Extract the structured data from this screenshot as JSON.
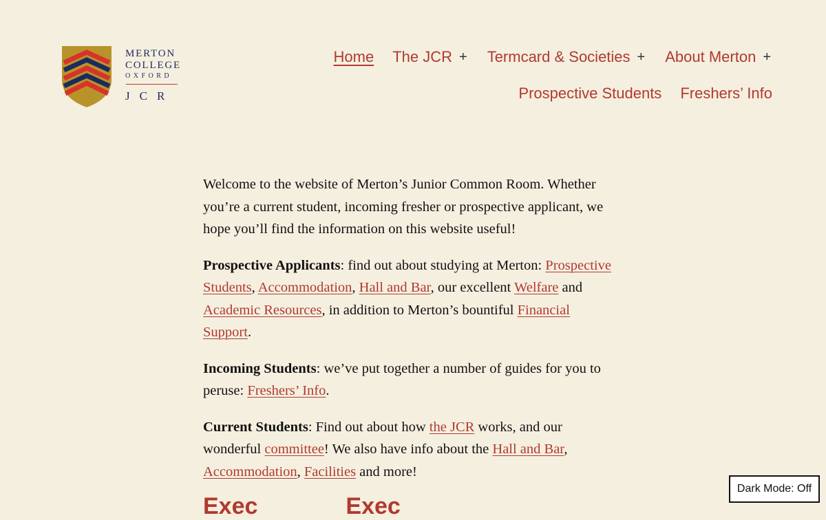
{
  "logo": {
    "line1": "MERTON",
    "line2": "COLLEGE",
    "line3": "OXFORD",
    "line4": "JCR",
    "colors": {
      "gold": "#b8932a",
      "navy": "#1d2b5c",
      "red": "#d8322b"
    }
  },
  "nav": {
    "items": [
      {
        "label": "Home",
        "current": true
      },
      {
        "label": "The JCR",
        "expand_symbol": "+"
      },
      {
        "label": "Termcard & Societies",
        "expand_symbol": "+"
      },
      {
        "label": "About Merton",
        "expand_symbol": "+"
      },
      {
        "label": "Prospective Students"
      },
      {
        "label": "Freshers’ Info"
      }
    ]
  },
  "content": {
    "intro": "Welcome to the website of Merton’s Junior Common Room. Whether you’re a current student, incoming fresher or prospective applicant, we hope you’ll find the information on this website useful!",
    "applicants": {
      "label": "Prospective Applicants",
      "t1": ": find out about studying at Merton: ",
      "l1": "Prospective Students",
      "t2": ", ",
      "l2": "Accommodation",
      "t3": ", ",
      "l3": "Hall and Bar",
      "t4": ", our excellent ",
      "l4": "Welfare",
      "t5": " and ",
      "l5": "Academic Resources",
      "t6": ", in addition to Merton’s bountiful ",
      "l6": "Financial Support",
      "t7": "."
    },
    "incoming": {
      "label": "Incoming Students",
      "t1": ": we’ve put together a number of guides for you to peruse: ",
      "l1": "Freshers’ Info",
      "t2": "."
    },
    "current": {
      "label": "Current Students",
      "t1": ": Find out about how ",
      "l1": "the JCR",
      "t2": " works, and our wonderful ",
      "l2": "committee",
      "t3": "! We also have info about the ",
      "l3": "Hall and Bar",
      "t4": ", ",
      "l4": "Accommodation",
      "t5": ", ",
      "l5": "Facilities",
      "t6": " and more!"
    },
    "headings": [
      "Exec",
      "Exec"
    ]
  },
  "dark_mode": {
    "label": "Dark Mode: Off"
  },
  "colors": {
    "background": "#f5efe0",
    "accent": "#b03a2e"
  }
}
